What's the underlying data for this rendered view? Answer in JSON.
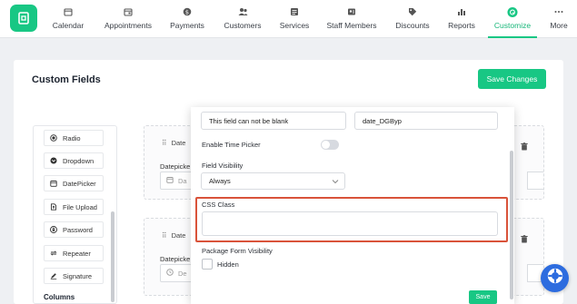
{
  "nav": {
    "items": [
      {
        "label": "Calendar",
        "icon": "calendar-icon"
      },
      {
        "label": "Appointments",
        "icon": "calendar-check-icon"
      },
      {
        "label": "Payments",
        "icon": "dollar-icon"
      },
      {
        "label": "Customers",
        "icon": "users-icon"
      },
      {
        "label": "Services",
        "icon": "list-icon"
      },
      {
        "label": "Staff Members",
        "icon": "staff-icon"
      },
      {
        "label": "Discounts",
        "icon": "tag-icon"
      },
      {
        "label": "Reports",
        "icon": "chart-icon"
      },
      {
        "label": "Customize",
        "icon": "palette-icon",
        "active": true
      },
      {
        "label": "More",
        "icon": "more-icon"
      }
    ],
    "accent": "#18c784"
  },
  "page": {
    "title": "Custom Fields",
    "save_changes": "Save Changes"
  },
  "sidebar": {
    "items": [
      {
        "label": "Radio",
        "icon": "radio-icon"
      },
      {
        "label": "Dropdown",
        "icon": "dropdown-icon"
      },
      {
        "label": "DatePicker",
        "icon": "calendar-icon"
      },
      {
        "label": "File Upload",
        "icon": "upload-icon"
      },
      {
        "label": "Password",
        "icon": "lock-icon"
      },
      {
        "label": "Repeater",
        "icon": "repeat-icon"
      },
      {
        "label": "Signature",
        "icon": "pen-icon"
      }
    ],
    "columns_label": "Columns"
  },
  "cards": [
    {
      "drag_label": "Date",
      "field_label": "Datepicke",
      "input_text": "Da"
    },
    {
      "drag_label": "Date",
      "field_label": "Datepicke",
      "input_text": "De"
    }
  ],
  "modal": {
    "error_message_value": "This field can not be blank",
    "field_id_value": "date_DGByp",
    "enable_time_picker_label": "Enable Time Picker",
    "field_visibility_label": "Field Visibility",
    "field_visibility_value": "Always",
    "css_class_label": "CSS Class",
    "css_class_value": "",
    "package_visibility_label": "Package Form Visibility",
    "hidden_label": "Hidden",
    "save_label": "Save",
    "highlight_color": "#d9533a"
  }
}
